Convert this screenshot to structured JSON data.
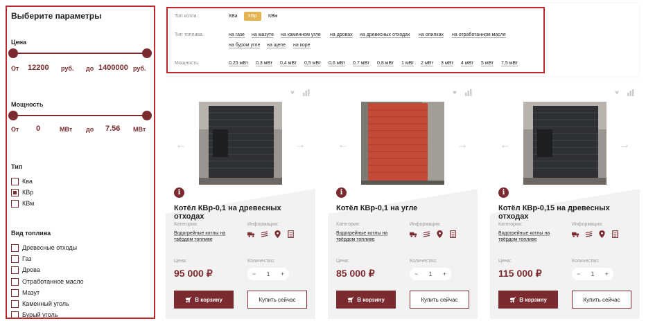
{
  "sidebar": {
    "title": "Выберите параметры",
    "price": {
      "label": "Цена",
      "from_label": "От",
      "from_value": "12200",
      "from_unit": "руб.",
      "to_label": "до",
      "to_value": "1400000",
      "to_unit": "руб."
    },
    "power": {
      "label": "Мощность",
      "from_label": "От",
      "from_value": "0",
      "from_unit": "МВт",
      "to_label": "до",
      "to_value": "7.56",
      "to_unit": "МВт"
    },
    "type": {
      "label": "Тип",
      "items": [
        {
          "label": "Ква",
          "checked": false
        },
        {
          "label": "КВр",
          "checked": true
        },
        {
          "label": "КВм",
          "checked": false
        }
      ]
    },
    "fuel": {
      "label": "Вид топлива",
      "items": [
        {
          "label": "Древесные отходы",
          "checked": false
        },
        {
          "label": "Газ",
          "checked": false
        },
        {
          "label": "Дрова",
          "checked": false
        },
        {
          "label": "Отработанное масло",
          "checked": false
        },
        {
          "label": "Мазут",
          "checked": false
        },
        {
          "label": "Каменный уголь",
          "checked": false
        },
        {
          "label": "Бурый уголь",
          "checked": false
        }
      ]
    }
  },
  "filter": {
    "boiler_type_label": "Тип котла :",
    "boiler_types": [
      "КВа",
      "КВр",
      "КВм"
    ],
    "boiler_type_selected": "КВр",
    "fuel_label": "Тип топлива:",
    "fuels_row1": [
      "на газе",
      "на мазуте",
      "на каменном угле",
      "на дровах",
      "на древесных отходах",
      "на опилках",
      "на отработанном масле"
    ],
    "fuels_row2": [
      "на буром угле",
      "на щепе",
      "на коре"
    ],
    "power_label": "Мощность:",
    "powers": [
      "0,25 мВт",
      "0,3 мВт",
      "0,4 мВт",
      "0,5 мВт",
      "0,6 мВт",
      "0,7 мВт",
      "0,8 мВт",
      "1 мВт",
      "2 мВт",
      "3 мВт",
      "4 мВт",
      "5 мВт",
      "7,5 мВт"
    ]
  },
  "cards": [
    {
      "title": "Котёл КВр-0,1 на древесных отходах",
      "category_label": "Категория:",
      "category": "Водогрейные котлы на твёрдом топливе",
      "info_label": "Информация:",
      "price_label": "Цена:",
      "price": "95 000 ₽",
      "qty_label": "Количество:",
      "qty": "1",
      "cart_label": "В корзину",
      "buy_label": "Купить сейчас",
      "photo_color": "dark"
    },
    {
      "title": "Котёл КВр-0,1 на угле",
      "category_label": "Категория:",
      "category": "Водогрейные котлы на твёрдом топливе",
      "info_label": "Информация:",
      "price_label": "Цена:",
      "price": "85 000 ₽",
      "qty_label": "Количество:",
      "qty": "1",
      "cart_label": "В корзину",
      "buy_label": "Купить сейчас",
      "photo_color": "red"
    },
    {
      "title": "Котёл КВр-0,15 на древесных отходах",
      "category_label": "Категория:",
      "category": "Водогрейные котлы на твёрдом топливе",
      "info_label": "Информация:",
      "price_label": "Цена:",
      "price": "115 000 ₽",
      "qty_label": "Количество:",
      "qty": "1",
      "cart_label": "В корзину",
      "buy_label": "Купить сейчас",
      "photo_color": "dark"
    }
  ],
  "colors": {
    "accent": "#7b2a2f",
    "highlight_border": "#c0272d",
    "selected_chip": "#e5b34f"
  }
}
